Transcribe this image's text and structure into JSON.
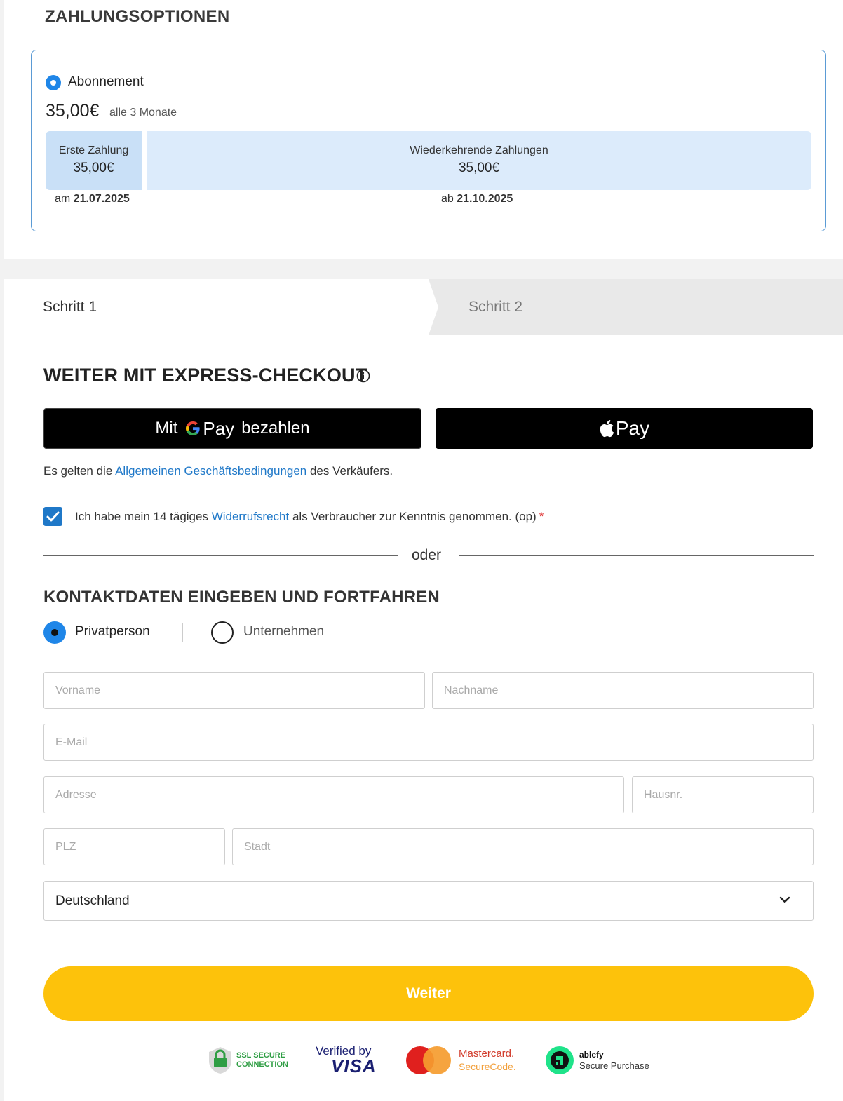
{
  "payment_options": {
    "title": "ZAHLUNGSOPTIONEN",
    "plan_name": "Abonnement",
    "plan_price": "35,00€",
    "plan_interval": "alle 3 Monate",
    "first_payment": {
      "label": "Erste Zahlung",
      "amount": "35,00€",
      "date_prefix": "am",
      "date": "21.07.2025"
    },
    "recurring_payment": {
      "label": "Wiederkehrende Zahlungen",
      "amount": "35,00€",
      "date_prefix": "ab",
      "date": "21.10.2025"
    }
  },
  "steps": {
    "step1": "Schritt 1",
    "step2": "Schritt 2"
  },
  "express": {
    "title": "WEITER MIT EXPRESS-CHECKOUT",
    "gpay": {
      "prefix": "Mit",
      "pay": "Pay",
      "suffix": "bezahlen"
    },
    "apay": "Pay"
  },
  "terms": {
    "before": "Es gelten die",
    "link": "Allgemeinen Geschäftsbedingungen",
    "after": "des Verkäufers."
  },
  "consent": {
    "checked": true,
    "before": "Ich habe mein 14 tägiges",
    "link": "Widerrufsrecht",
    "after": "als Verbraucher zur Kenntnis genommen.  (op)",
    "required_mark": "*"
  },
  "divider": "oder",
  "contact": {
    "title": "KONTAKTDATEN EINGEBEN UND FORTFAHREN",
    "type_private": "Privatperson",
    "type_company": "Unternehmen",
    "placeholders": {
      "firstname": "Vorname",
      "lastname": "Nachname",
      "email": "E-Mail",
      "address": "Adresse",
      "house_no": "Hausnr.",
      "zip": "PLZ",
      "city": "Stadt"
    },
    "country": "Deutschland"
  },
  "submit": "Weiter",
  "badges": {
    "ssl_line1": "SSL SECURE",
    "ssl_line2": "CONNECTION",
    "visa_line1": "Verified by",
    "visa_line2": "VISA",
    "mc_line1": "Mastercard.",
    "mc_line2": "SecureCode.",
    "ablefy_line1": "ablefy",
    "ablefy_line2": "Secure Purchase"
  },
  "colors": {
    "accent": "#1f86e8",
    "link": "#1f78c8",
    "submit": "#fdc20b",
    "plan_border": "#5b9bd5"
  }
}
